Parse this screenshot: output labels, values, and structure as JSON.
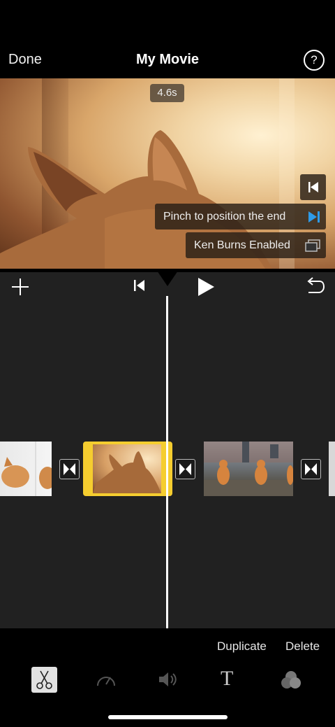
{
  "header": {
    "done_label": "Done",
    "title": "My Movie",
    "help_label": "?"
  },
  "preview": {
    "duration": "4.6s",
    "pinch_hint": "Pinch to position the end",
    "ken_burns_label": "Ken Burns Enabled"
  },
  "timeline_toolbar": {
    "add_icon": "plus-icon",
    "skip_start_icon": "skip-to-start-icon",
    "play_icon": "play-icon",
    "undo_icon": "undo-icon"
  },
  "actions": {
    "duplicate_label": "Duplicate",
    "delete_label": "Delete"
  },
  "tools": [
    "scissors-icon",
    "speedometer-icon",
    "volume-icon",
    "title-icon",
    "filters-icon"
  ],
  "tools_title_glyph": "T",
  "colors": {
    "accent_selection": "#f5cd2f",
    "accent_blue": "#2e9be8",
    "timeline_bg": "#212121"
  }
}
